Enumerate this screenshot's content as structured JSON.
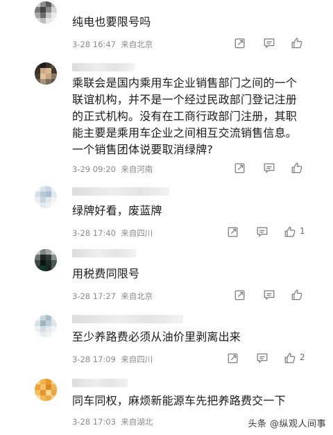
{
  "comments": [
    {
      "text": "纯电也要限号吗",
      "time": "3-28 16:47",
      "location": "来自北京",
      "likes": ""
    },
    {
      "text": "乘联会是国内乘用车企业销售部门之间的一个联谊机构，并不是一个经过民政部门登记注册的正式机构。没有在工商行政部门注册，其职能主要是乘用车企业之间相互交流销售信息。一个销售团体说要取消绿牌?",
      "time": "3-29 09:20",
      "location": "来自河南",
      "likes": ""
    },
    {
      "text": "绿牌好看，废蓝牌",
      "time": "3-28 17:40",
      "location": "来自四川",
      "likes": "1"
    },
    {
      "text": "用税费同限号",
      "time": "3-28 17:27",
      "location": "来自北京",
      "likes": ""
    },
    {
      "text": "至少养路费必须从油价里剥离出来",
      "time": "3-28 17:09",
      "location": "来自四川",
      "likes": "2"
    },
    {
      "text": "同车同权，麻烦新能源车先把养路费交一下",
      "time": "3-28 17:03",
      "location": "来自湖北",
      "likes": ""
    }
  ],
  "icons": {
    "reply": "reply-icon",
    "comment": "comment-icon",
    "like": "thumb-up-icon"
  },
  "colors": {
    "text": "#1a1a1a",
    "meta": "#8a8a8a",
    "icon": "#7a7a7a"
  },
  "watermark": "头条 @纵观人间事"
}
